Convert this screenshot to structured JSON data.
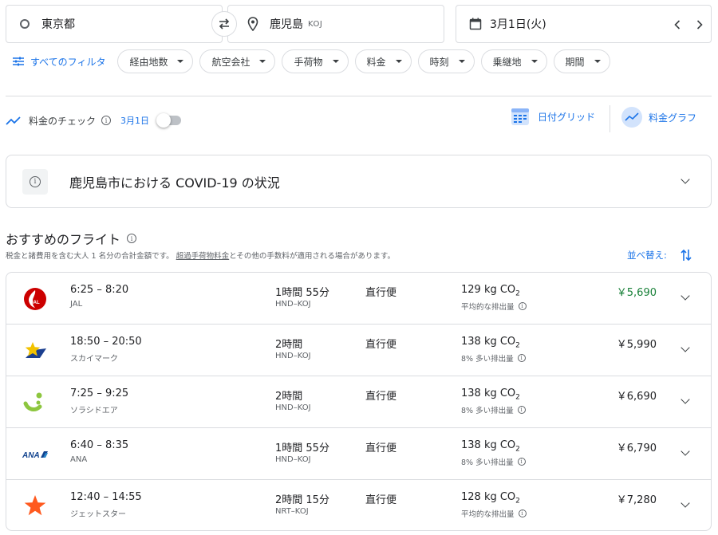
{
  "search": {
    "origin": "東京都",
    "destination": "鹿児島",
    "destination_code": "KOJ",
    "date": "3月1日(火)"
  },
  "filters": {
    "all_label": "すべてのフィルタ",
    "chips": [
      "経由地数",
      "航空会社",
      "手荷物",
      "料金",
      "時刻",
      "乗継地",
      "期間"
    ]
  },
  "tracking": {
    "label": "料金のチェック",
    "date": "3月1日",
    "date_grid_label": "日付グリッド",
    "price_graph_label": "料金グラフ"
  },
  "covid": {
    "title": "鹿児島市における COVID-19 の状況"
  },
  "section": {
    "title": "おすすめのフライト",
    "subtitle_pre": "税金と諸費用を含む大人 1 名分の合計金額です。",
    "subtitle_link": "超過手荷物料金",
    "subtitle_post": "とその他の手数料が適用される場合があります。",
    "sort_label": "並べ替え:"
  },
  "flights": [
    {
      "times": "6:25 – 8:20",
      "airline": "JAL",
      "duration": "1時間 55分",
      "route": "HND–KOJ",
      "stops": "直行便",
      "co2": "129 kg CO",
      "emission": "平均的な排出量",
      "price": "￥5,690",
      "price_color": "#188038",
      "logo": "jal-logo"
    },
    {
      "times": "18:50 – 20:50",
      "airline": "スカイマーク",
      "duration": "2時間",
      "route": "HND–KOJ",
      "stops": "直行便",
      "co2": "138 kg CO",
      "emission": "8% 多い排出量",
      "price": "￥5,990",
      "logo": "skymark-logo"
    },
    {
      "times": "7:25 – 9:25",
      "airline": "ソラシドエア",
      "duration": "2時間",
      "route": "HND–KOJ",
      "stops": "直行便",
      "co2": "138 kg CO",
      "emission": "8% 多い排出量",
      "price": "￥6,690",
      "logo": "solaseed-logo"
    },
    {
      "times": "6:40 – 8:35",
      "airline": "ANA",
      "duration": "1時間 55分",
      "route": "HND–KOJ",
      "stops": "直行便",
      "co2": "138 kg CO",
      "emission": "8% 多い排出量",
      "price": "￥6,790",
      "logo": "ana-logo"
    },
    {
      "times": "12:40 – 14:55",
      "airline": "ジェットスター",
      "duration": "2時間 15分",
      "route": "NRT–KOJ",
      "stops": "直行便",
      "co2": "128 kg CO",
      "emission": "平均的な排出量",
      "price": "￥7,280",
      "logo": "jetstar-logo"
    }
  ],
  "colors": {
    "accent": "#1a73e8",
    "cheapest_price": "#188038"
  }
}
